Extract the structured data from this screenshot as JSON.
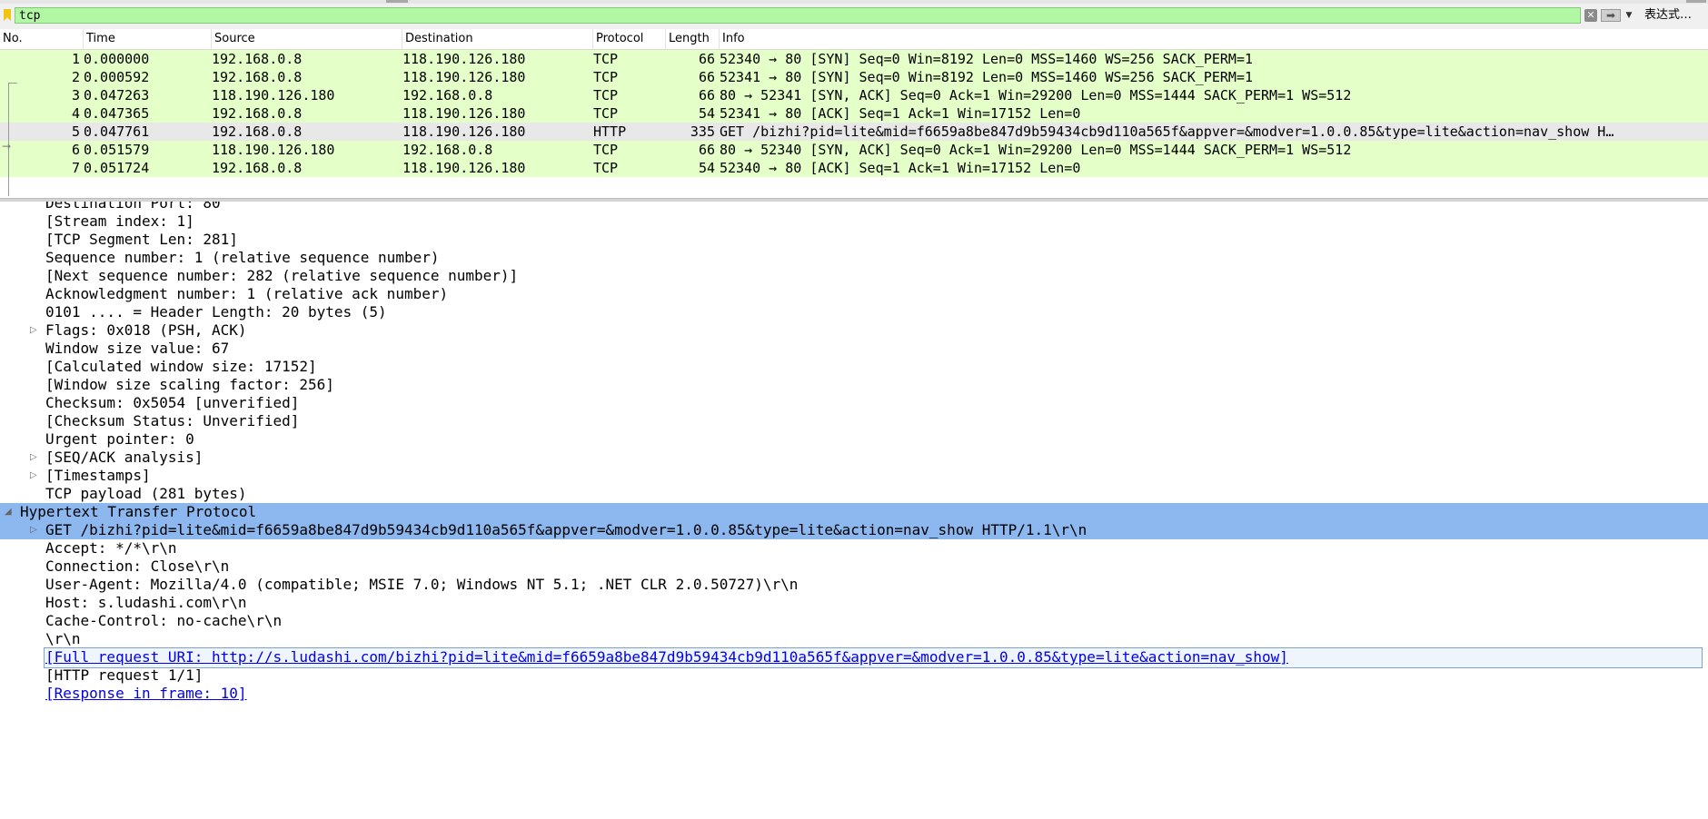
{
  "filter": {
    "value": "tcp",
    "expression_label": "表达式…",
    "colors": {
      "valid_background": "#b2f7a4"
    },
    "icons": {
      "bookmark": "bookmark-icon",
      "clear": "clear-icon",
      "apply": "apply-arrow-icon",
      "dropdown": "chevron-down-icon"
    }
  },
  "packet_list": {
    "columns": [
      "No.",
      "Time",
      "Source",
      "Destination",
      "Protocol",
      "Length",
      "Info"
    ],
    "rows": [
      {
        "no": "1",
        "time": "0.000000",
        "source": "192.168.0.8",
        "destination": "118.190.126.180",
        "protocol": "TCP",
        "length": "66",
        "info": "52340 → 80 [SYN] Seq=0 Win=8192 Len=0 MSS=1460 WS=256 SACK_PERM=1",
        "color": "#e4ffc7"
      },
      {
        "no": "2",
        "time": "0.000592",
        "source": "192.168.0.8",
        "destination": "118.190.126.180",
        "protocol": "TCP",
        "length": "66",
        "info": "52341 → 80 [SYN] Seq=0 Win=8192 Len=0 MSS=1460 WS=256 SACK_PERM=1",
        "color": "#e4ffc7"
      },
      {
        "no": "3",
        "time": "0.047263",
        "source": "118.190.126.180",
        "destination": "192.168.0.8",
        "protocol": "TCP",
        "length": "66",
        "info": "80 → 52341 [SYN, ACK] Seq=0 Ack=1 Win=29200 Len=0 MSS=1444 SACK_PERM=1 WS=512",
        "color": "#e4ffc7"
      },
      {
        "no": "4",
        "time": "0.047365",
        "source": "192.168.0.8",
        "destination": "118.190.126.180",
        "protocol": "TCP",
        "length": "54",
        "info": "52341 → 80 [ACK] Seq=1 Ack=1 Win=17152 Len=0",
        "color": "#e4ffc7"
      },
      {
        "no": "5",
        "time": "0.047761",
        "source": "192.168.0.8",
        "destination": "118.190.126.180",
        "protocol": "HTTP",
        "length": "335",
        "info": "GET /bizhi?pid=lite&mid=f6659a8be847d9b59434cb9d110a565f&appver=&modver=1.0.0.85&type=lite&action=nav_show H…",
        "color": "#e8e8e8",
        "selected": true
      },
      {
        "no": "6",
        "time": "0.051579",
        "source": "118.190.126.180",
        "destination": "192.168.0.8",
        "protocol": "TCP",
        "length": "66",
        "info": "80 → 52340 [SYN, ACK] Seq=0 Ack=1 Win=29200 Len=0 MSS=1444 SACK_PERM=1 WS=512",
        "color": "#e4ffc7"
      },
      {
        "no": "7",
        "time": "0.051724",
        "source": "192.168.0.8",
        "destination": "118.190.126.180",
        "protocol": "TCP",
        "length": "54",
        "info": "52340 → 80 [ACK] Seq=1 Ack=1 Win=17152 Len=0",
        "color": "#e4ffc7"
      }
    ]
  },
  "details": {
    "highlight_color": "#8cb8ef",
    "rows": [
      {
        "text": "Destination Port: 80",
        "indent": 1
      },
      {
        "text": "[Stream index: 1]",
        "indent": 1
      },
      {
        "text": "[TCP Segment Len: 281]",
        "indent": 1
      },
      {
        "text": "Sequence number: 1    (relative sequence number)",
        "indent": 1
      },
      {
        "text": "[Next sequence number: 282    (relative sequence number)]",
        "indent": 1
      },
      {
        "text": "Acknowledgment number: 1    (relative ack number)",
        "indent": 1
      },
      {
        "text": "0101 .... = Header Length: 20 bytes (5)",
        "indent": 1
      },
      {
        "text": "Flags: 0x018 (PSH, ACK)",
        "indent": 1,
        "toggle": "collapsed"
      },
      {
        "text": "Window size value: 67",
        "indent": 1
      },
      {
        "text": "[Calculated window size: 17152]",
        "indent": 1
      },
      {
        "text": "[Window size scaling factor: 256]",
        "indent": 1
      },
      {
        "text": "Checksum: 0x5054 [unverified]",
        "indent": 1
      },
      {
        "text": "[Checksum Status: Unverified]",
        "indent": 1
      },
      {
        "text": "Urgent pointer: 0",
        "indent": 1
      },
      {
        "text": "[SEQ/ACK analysis]",
        "indent": 1,
        "toggle": "collapsed"
      },
      {
        "text": "[Timestamps]",
        "indent": 1,
        "toggle": "collapsed"
      },
      {
        "text": "TCP payload (281 bytes)",
        "indent": 1
      },
      {
        "text": "Hypertext Transfer Protocol",
        "indent": 0,
        "toggle": "expanded",
        "highlight": true
      },
      {
        "text": "GET /bizhi?pid=lite&mid=f6659a8be847d9b59434cb9d110a565f&appver=&modver=1.0.0.85&type=lite&action=nav_show HTTP/1.1\\r\\n",
        "indent": 1,
        "toggle": "collapsed",
        "highlight": true
      },
      {
        "text": "Accept: */*\\r\\n",
        "indent": 1
      },
      {
        "text": "Connection: Close\\r\\n",
        "indent": 1
      },
      {
        "text": "User-Agent: Mozilla/4.0 (compatible; MSIE 7.0; Windows NT 5.1; .NET CLR 2.0.50727)\\r\\n",
        "indent": 1
      },
      {
        "text": "Host: s.ludashi.com\\r\\n",
        "indent": 1
      },
      {
        "text": "Cache-Control: no-cache\\r\\n",
        "indent": 1
      },
      {
        "text": "\\r\\n",
        "indent": 1
      },
      {
        "text": "[Full request URI: http://s.ludashi.com/bizhi?pid=lite&mid=f6659a8be847d9b59434cb9d110a565f&appver=&modver=1.0.0.85&type=lite&action=nav_show]",
        "indent": 1,
        "link": true,
        "boxed": true
      },
      {
        "text": "[HTTP request 1/1]",
        "indent": 1
      },
      {
        "text": "[Response in frame: 10]",
        "indent": 1,
        "link": true
      }
    ]
  }
}
